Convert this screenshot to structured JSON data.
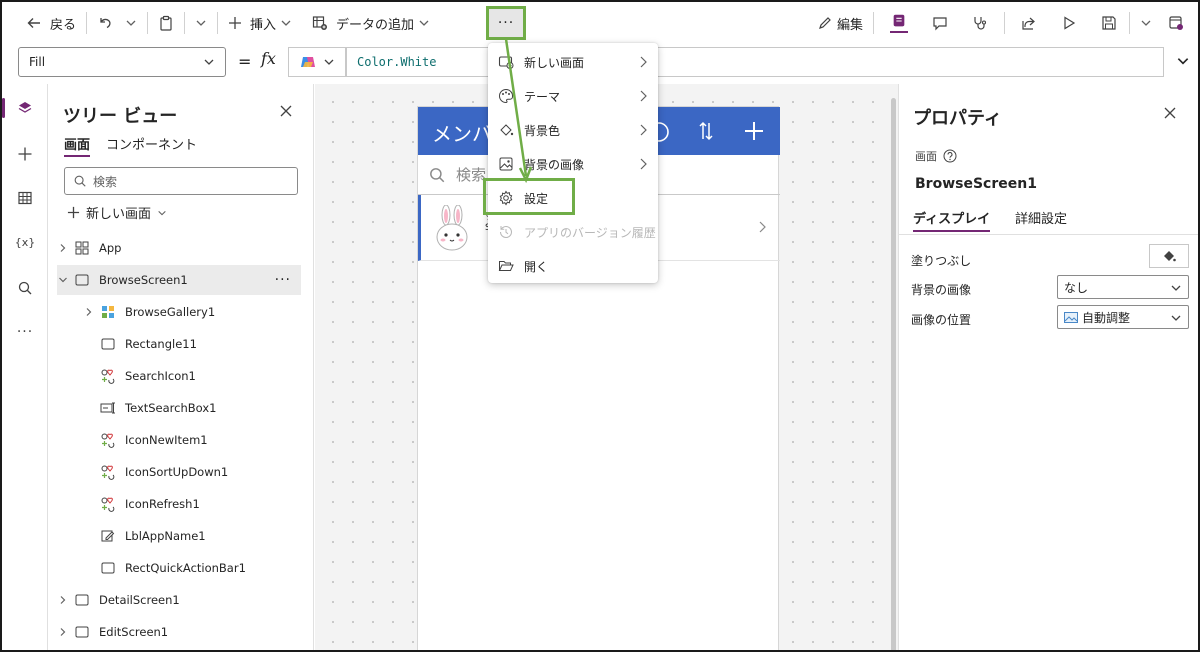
{
  "toolbar": {
    "back": "戻る",
    "insert": "挿入",
    "add_data": "データの追加",
    "more": "···",
    "edit": "編集"
  },
  "formula_bar": {
    "property": "Fill",
    "equals": "=",
    "fx": "fx",
    "formula": "Color.White"
  },
  "tree_view": {
    "title": "ツリー ビュー",
    "tabs": [
      "画面",
      "コンポーネント"
    ],
    "search_placeholder": "検索",
    "new_screen": "新しい画面",
    "items": [
      {
        "label": "App",
        "type": "app",
        "expandable": true
      },
      {
        "label": "BrowseScreen1",
        "type": "screen",
        "expandable": true,
        "expanded": true,
        "selected": true
      },
      {
        "label": "BrowseGallery1",
        "type": "gallery",
        "expandable": true
      },
      {
        "label": "Rectangle11",
        "type": "rectangle"
      },
      {
        "label": "SearchIcon1",
        "type": "icon"
      },
      {
        "label": "TextSearchBox1",
        "type": "textinput"
      },
      {
        "label": "IconNewItem1",
        "type": "icon"
      },
      {
        "label": "IconSortUpDown1",
        "type": "icon"
      },
      {
        "label": "IconRefresh1",
        "type": "icon"
      },
      {
        "label": "LblAppName1",
        "type": "label"
      },
      {
        "label": "RectQuickActionBar1",
        "type": "rectangle"
      },
      {
        "label": "DetailScreen1",
        "type": "screen",
        "expandable": true
      },
      {
        "label": "EditScreen1",
        "type": "screen",
        "expandable": true
      }
    ]
  },
  "canvas": {
    "app_title": "メンバ",
    "search_placeholder": "検索",
    "row_subtext_1": "ッ",
    "row_subtext_2": "S"
  },
  "more_menu": {
    "items": [
      {
        "label": "新しい画面",
        "icon": "new-screen-icon",
        "submenu": true
      },
      {
        "label": "テーマ",
        "icon": "palette-icon",
        "submenu": true
      },
      {
        "label": "背景色",
        "icon": "paint-bucket-icon",
        "submenu": true
      },
      {
        "label": "背景の画像",
        "icon": "image-icon",
        "submenu": true
      },
      {
        "label": "設定",
        "icon": "settings-icon",
        "highlighted": true
      },
      {
        "label": "アプリのバージョン履歴",
        "icon": "history-icon",
        "disabled": true
      },
      {
        "label": "開く",
        "icon": "folder-open-icon"
      }
    ]
  },
  "properties": {
    "title": "プロパティ",
    "kind": "画面",
    "name": "BrowseScreen1",
    "tabs": [
      "ディスプレイ",
      "詳細設定"
    ],
    "fill_label": "塗りつぶし",
    "bg_image_label": "背景の画像",
    "bg_image_value": "なし",
    "image_position_label": "画像の位置",
    "image_position_value": "自動調整"
  },
  "colors": {
    "accent": "#742774",
    "header_blue": "#3b67c4",
    "highlight_green": "#70ad47"
  }
}
